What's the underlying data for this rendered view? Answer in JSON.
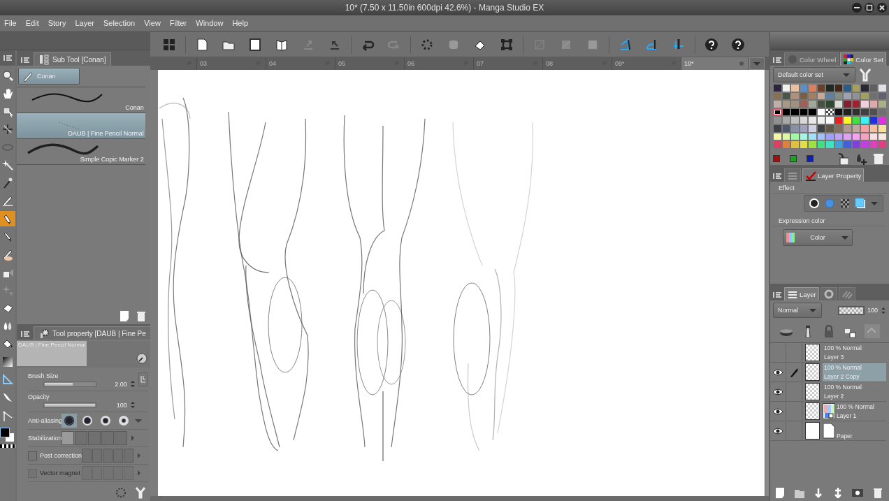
{
  "window": {
    "title": "10* (7.50 x 11.50in 600dpi 42.6%)  - Manga Studio EX"
  },
  "menu": [
    "File",
    "Edit",
    "Story",
    "Layer",
    "Selection",
    "View",
    "Filter",
    "Window",
    "Help"
  ],
  "canvas_tabs": [
    {
      "label": "03",
      "selected": false
    },
    {
      "label": "04",
      "selected": false
    },
    {
      "label": "05",
      "selected": false
    },
    {
      "label": "06",
      "selected": false
    },
    {
      "label": "07",
      "selected": false
    },
    {
      "label": "08",
      "selected": false
    },
    {
      "label": "09*",
      "selected": false
    },
    {
      "label": "10*",
      "selected": true
    }
  ],
  "tools": [
    {
      "kind": "zoom",
      "selected": false
    },
    {
      "kind": "hand",
      "selected": false
    },
    {
      "kind": "object",
      "selected": false
    },
    {
      "kind": "move",
      "selected": false
    },
    {
      "kind": "lasso",
      "selected": false
    },
    {
      "kind": "wand",
      "selected": false
    },
    {
      "kind": "dropper",
      "selected": false
    },
    {
      "kind": "pen",
      "selected": false
    },
    {
      "kind": "pencil",
      "selected": true
    },
    {
      "kind": "brush",
      "selected": false
    },
    {
      "kind": "deco",
      "selected": false
    },
    {
      "kind": "airbrush",
      "selected": false
    },
    {
      "kind": "sparkle",
      "selected": false
    },
    {
      "kind": "eraser",
      "selected": false
    },
    {
      "kind": "blend",
      "selected": false
    },
    {
      "kind": "fill",
      "selected": false
    },
    {
      "kind": "gradient",
      "selected": false
    },
    {
      "kind": "ruler",
      "selected": false
    },
    {
      "kind": "balloon",
      "selected": false
    },
    {
      "kind": "line",
      "selected": false
    }
  ],
  "sub_tool": {
    "tab": "Sub Tool [Conan]",
    "group": "Conan",
    "brushes": [
      {
        "name": "Conan",
        "kind": "stroke",
        "selected": false
      },
      {
        "name": "DAUB | Fine Pencil Normal",
        "kind": "dots",
        "selected": true
      },
      {
        "name": "Simple Copic Marker 2",
        "kind": "marker",
        "selected": false
      }
    ]
  },
  "tool_property": {
    "tab": "Tool property [DAUB | Fine Pe",
    "preview_label": "DAUB | Fine Pencil Normal",
    "brush_size": {
      "label": "Brush Size",
      "value": "2.00",
      "level": 0.56
    },
    "opacity": {
      "label": "Opacity",
      "value": "100",
      "level": 1
    },
    "anti_aliasing": {
      "label": "Anti-aliasing",
      "options": [
        {
          "selected": true
        },
        {
          "selected": false
        },
        {
          "selected": false
        },
        {
          "selected": false
        }
      ]
    },
    "stabilization": {
      "label": "Stabilization",
      "options": [
        {
          "selected": true
        },
        {
          "selected": false
        },
        {
          "selected": false
        },
        {
          "selected": false
        },
        {
          "selected": false
        }
      ]
    },
    "post_correction": {
      "label": "Post correction",
      "checked": false,
      "disabled": false
    },
    "vector_magnet": {
      "label": "Vector magnet",
      "checked": false,
      "disabled": true
    }
  },
  "color_panel": {
    "tabs": [
      {
        "label": "Color Wheel",
        "selected": false
      },
      {
        "label": "Color Set",
        "selected": true
      }
    ],
    "set_name": "Default color set",
    "swatches": [
      [
        {
          "color": "#2e2440",
          "selected": false
        },
        {
          "color": "#f0f0ee",
          "selected": false
        },
        {
          "color": "#e8c0a0",
          "selected": false
        },
        {
          "color": "#5a90c8",
          "selected": false
        },
        {
          "color": "#d88060",
          "selected": false
        },
        {
          "color": "#6a4028",
          "selected": false
        },
        {
          "color": "#202820",
          "selected": false
        },
        {
          "color": "#402818",
          "selected": false
        },
        {
          "color": "#2a5c88",
          "selected": false
        },
        {
          "color": "#a8a060",
          "selected": false
        },
        {
          "color": "#282830",
          "selected": false
        },
        {
          "color": "#606060",
          "selected": false
        },
        {
          "color": "#e0e0e8",
          "selected": false
        }
      ],
      [
        {
          "color": "#8a7050",
          "selected": false
        },
        {
          "color": "#485848",
          "selected": false
        },
        {
          "color": "#b09078",
          "selected": false
        },
        {
          "color": "#786048",
          "selected": false
        },
        {
          "color": "#a08060",
          "selected": false
        },
        {
          "color": "#c8a898",
          "selected": false
        },
        {
          "color": "#6080a0",
          "selected": false
        },
        {
          "color": "#809080",
          "selected": false
        },
        {
          "color": "#a0a0b0",
          "selected": false
        },
        {
          "color": "#909098",
          "selected": false
        },
        {
          "color": "#a0a060",
          "selected": false
        },
        {
          "color": "#707070",
          "selected": false
        },
        {
          "color": "#606070",
          "selected": false
        }
      ],
      [
        {
          "color": "#c0b0a8",
          "selected": false
        },
        {
          "color": "#a89888",
          "selected": false
        },
        {
          "color": "#a09080",
          "selected": false
        },
        {
          "color": "#a06058",
          "selected": false
        },
        {
          "color": "#a0a898",
          "selected": false
        },
        {
          "color": "#485040",
          "selected": false
        },
        {
          "color": "#304830",
          "selected": false
        },
        {
          "color": "#d8e0d8",
          "selected": false
        },
        {
          "color": "#802030",
          "selected": false
        },
        {
          "color": "#a02030",
          "selected": false
        },
        {
          "color": "#f0d0d8",
          "selected": false
        },
        {
          "color": "#e0a8a8",
          "selected": false
        },
        {
          "color": "#a8b088",
          "selected": false
        }
      ],
      [
        {
          "color": "#000000",
          "selected": true
        },
        {
          "color": "#000000",
          "selected": false
        },
        {
          "color": "#000000",
          "selected": false
        },
        {
          "color": "#000000",
          "selected": false
        },
        {
          "color": "#000000",
          "selected": false
        },
        {
          "color": "#ffffff",
          "selected": false
        },
        {
          "kind": "transparent",
          "selected": false
        },
        {
          "color": "#101010",
          "selected": false
        },
        {
          "color": "#202020",
          "selected": false
        },
        {
          "color": "#303030",
          "selected": false
        },
        {
          "color": "#404040",
          "selected": false
        },
        {
          "color": "#505050",
          "selected": false
        },
        {
          "color": "#707070",
          "selected": false
        }
      ],
      [
        {
          "color": "#909090",
          "selected": false
        },
        {
          "color": "#a8a8a8",
          "selected": false
        },
        {
          "color": "#c0c0c0",
          "selected": false
        },
        {
          "color": "#d8d8d8",
          "selected": false
        },
        {
          "color": "#e8e8e8",
          "selected": false
        },
        {
          "color": "#f0f0f0",
          "selected": false
        },
        {
          "color": "#f8f8f8",
          "selected": false
        },
        {
          "color": "#e82020",
          "selected": false
        },
        {
          "color": "#f8f820",
          "selected": false
        },
        {
          "color": "#40e040",
          "selected": false
        },
        {
          "color": "#40f0f0",
          "selected": false
        },
        {
          "color": "#2030e0",
          "selected": false
        },
        {
          "color": "#e030e0",
          "selected": false
        }
      ],
      [
        {
          "color": "#404048",
          "selected": false
        },
        {
          "color": "#505868",
          "selected": false
        },
        {
          "color": "#8890a8",
          "selected": false
        },
        {
          "color": "#a0a0c0",
          "selected": false
        },
        {
          "color": "#d0d0e0",
          "selected": false
        },
        {
          "color": "#404040",
          "selected": false
        },
        {
          "color": "#605848",
          "selected": false
        },
        {
          "color": "#807060",
          "selected": false
        },
        {
          "color": "#b09890",
          "selected": false
        },
        {
          "color": "#c0a8a0",
          "selected": false
        },
        {
          "color": "#f0a0a0",
          "selected": false
        },
        {
          "color": "#f8c0a0",
          "selected": false
        },
        {
          "color": "#f8e0a0",
          "selected": false
        }
      ],
      [
        {
          "color": "#f8f8a0",
          "selected": false
        },
        {
          "color": "#e0f8a0",
          "selected": false
        },
        {
          "color": "#a0f8a0",
          "selected": false
        },
        {
          "color": "#a0f8e0",
          "selected": false
        },
        {
          "color": "#a0e0f8",
          "selected": false
        },
        {
          "color": "#a0c0f8",
          "selected": false
        },
        {
          "color": "#a0a0f8",
          "selected": false
        },
        {
          "color": "#c0a0f8",
          "selected": false
        },
        {
          "color": "#e0a0f8",
          "selected": false
        },
        {
          "color": "#f8a0f8",
          "selected": false
        },
        {
          "color": "#f8a0c0",
          "selected": false
        },
        {
          "color": "#f8e0e0",
          "selected": false
        },
        {
          "color": "#fce8e0",
          "selected": false
        }
      ],
      [
        {
          "color": "#e04060",
          "selected": false
        },
        {
          "color": "#e08040",
          "selected": false
        },
        {
          "color": "#e0c040",
          "selected": false
        },
        {
          "color": "#e0e040",
          "selected": false
        },
        {
          "color": "#a0e040",
          "selected": false
        },
        {
          "color": "#40e080",
          "selected": false
        },
        {
          "color": "#40e0c0",
          "selected": false
        },
        {
          "color": "#40a0e0",
          "selected": false
        },
        {
          "color": "#4060e0",
          "selected": false
        },
        {
          "color": "#8040e0",
          "selected": false
        },
        {
          "color": "#c040e0",
          "selected": false
        },
        {
          "color": "#e040c0",
          "selected": false
        },
        {
          "color": "#e04080",
          "selected": false
        }
      ]
    ],
    "recent": [
      {
        "color": "#a01010"
      },
      {
        "color": "#20a020"
      },
      {
        "color": "#1020b0"
      }
    ]
  },
  "layer_property": {
    "tabs": [
      {
        "kind": "lines",
        "selected": false
      },
      {
        "kind": "check",
        "label": "Layer Property",
        "selected": true
      }
    ],
    "effect_label": "Effect",
    "expression_label": "Expression color",
    "expression_value": "Color"
  },
  "layer_panel": {
    "tabs": [
      {
        "kind": "lines",
        "label": "Layer",
        "selected": true
      },
      {
        "kind": "ring",
        "selected": false
      },
      {
        "kind": "stripes",
        "selected": false
      }
    ],
    "blend_mode": "Normal",
    "opacity": "100",
    "opacity_slider": {
      "level": 1
    },
    "layers": [
      {
        "mode": "100 %  Normal",
        "name": "Layer 3",
        "kind": "raster",
        "visible": false,
        "editing": false,
        "selected": false
      },
      {
        "mode": "100 %  Normal",
        "name": "Layer 2 Copy",
        "kind": "raster",
        "visible": true,
        "editing": true,
        "selected": true
      },
      {
        "mode": "100 %  Normal",
        "name": "Layer 2",
        "kind": "raster",
        "visible": true,
        "editing": false,
        "selected": false
      },
      {
        "mode": "100 %  Normal",
        "name": "Layer 1",
        "kind": "color",
        "visible": true,
        "editing": false,
        "selected": false
      },
      {
        "name": "Paper",
        "kind": "paper",
        "visible": true,
        "editing": false,
        "selected": false
      }
    ]
  }
}
